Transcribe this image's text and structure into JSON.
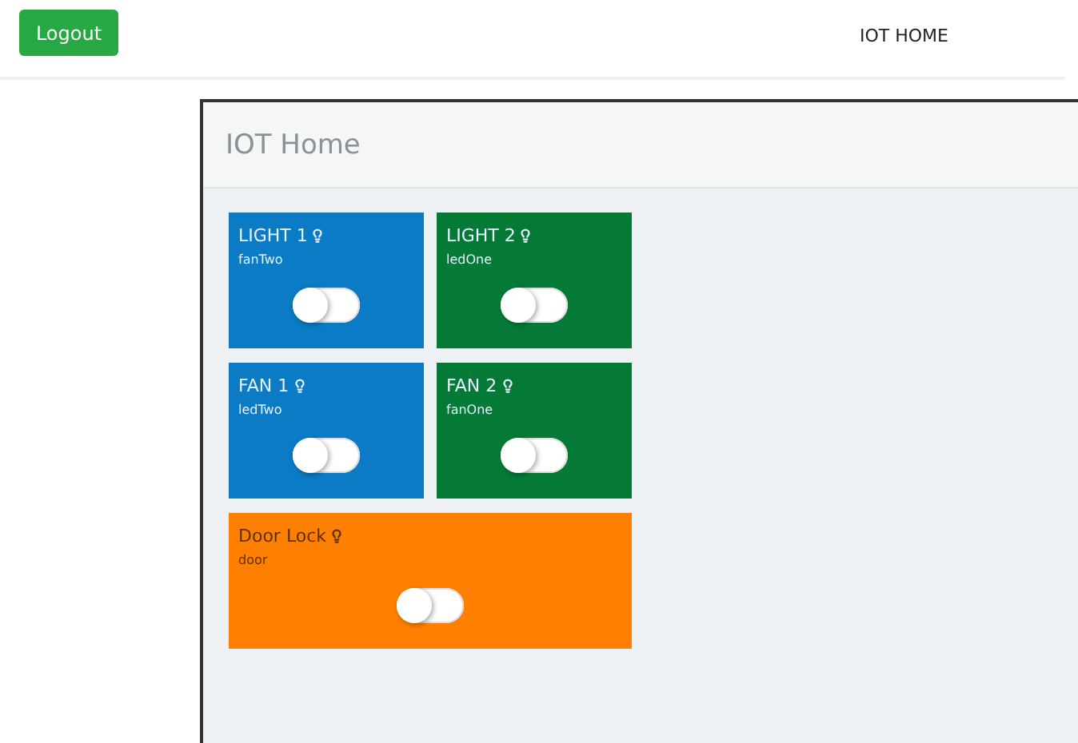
{
  "header": {
    "logout": "Logout",
    "brand": "IOT HOME"
  },
  "panel": {
    "title": "IOT Home"
  },
  "devices": [
    {
      "name": "LIGHT 1",
      "id": "fanTwo",
      "color": "#0a7bc4",
      "on": false,
      "wide": false
    },
    {
      "name": "LIGHT 2",
      "id": "ledOne",
      "color": "#057a36",
      "on": false,
      "wide": false
    },
    {
      "name": "FAN 1",
      "id": "ledTwo",
      "color": "#0a7bc4",
      "on": false,
      "wide": false
    },
    {
      "name": "FAN 2",
      "id": "fanOne",
      "color": "#057a36",
      "on": false,
      "wide": false
    },
    {
      "name": "Door Lock",
      "id": "door",
      "color": "#ff8000",
      "on": false,
      "wide": true
    }
  ]
}
